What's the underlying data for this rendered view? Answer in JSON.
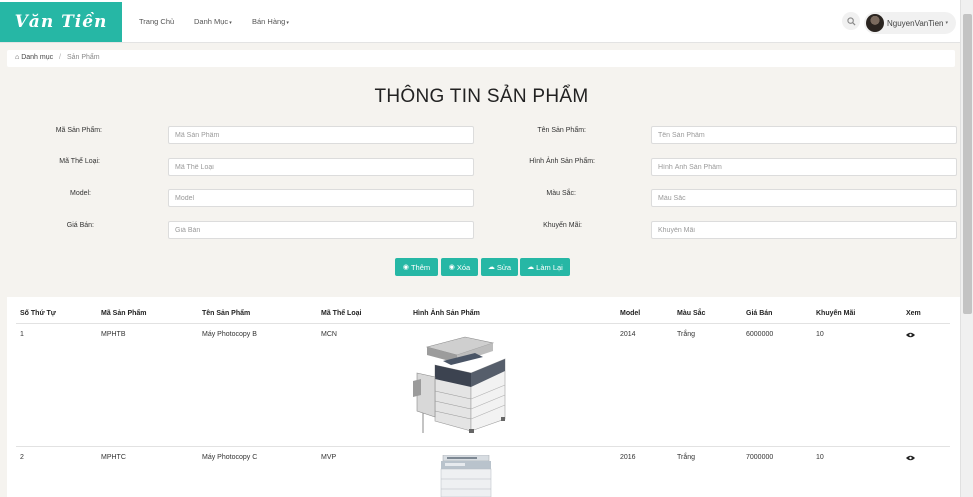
{
  "brand": {
    "logo_text": "Văn Tiền"
  },
  "nav": {
    "items": [
      {
        "label": "Trang Chủ",
        "has_caret": false
      },
      {
        "label": "Danh Mục",
        "has_caret": true
      },
      {
        "label": "Bán Hàng",
        "has_caret": true
      }
    ],
    "search_icon": "search-icon",
    "user": {
      "name": "NguyenVanTien",
      "caret": "▾"
    }
  },
  "breadcrumb": {
    "home_icon": "home-icon",
    "home_label": "Danh mục",
    "separator": "/",
    "current": "Sản Phẩm"
  },
  "page": {
    "title": "THÔNG TIN SẢN PHẨM"
  },
  "form": {
    "ma_san_pham": {
      "label": "Mã Sản Phẩm:",
      "placeholder": "Mã Sản Phẩm",
      "value": ""
    },
    "ten_san_pham": {
      "label": "Tên Sản Phẩm:",
      "placeholder": "Tên Sản Phẩm",
      "value": ""
    },
    "ma_the_loai": {
      "label": "Mã Thể Loại:",
      "placeholder": "Mã Thể Loại",
      "value": ""
    },
    "hinh_anh": {
      "label": "Hình Ảnh Sản Phẩm:",
      "placeholder": "Hình Ảnh Sản Phẩm",
      "value": ""
    },
    "model": {
      "label": "Model:",
      "placeholder": "Model",
      "value": ""
    },
    "mau_sac": {
      "label": "Màu Sắc:",
      "placeholder": "Màu Sắc",
      "value": ""
    },
    "gia_ban": {
      "label": "Giá Bán:",
      "placeholder": "Giá Bán",
      "value": ""
    },
    "khuyen_mai": {
      "label": "Khuyến Mãi:",
      "placeholder": "Khuyến Mãi",
      "value": ""
    }
  },
  "actions": {
    "add": {
      "label": "Thêm",
      "icon": "eye-icon"
    },
    "delete": {
      "label": "Xóa",
      "icon": "eye-icon"
    },
    "edit": {
      "label": "Sửa",
      "icon": "cloud-icon"
    },
    "reset": {
      "label": "Làm Lại",
      "icon": "cloud-icon"
    }
  },
  "table": {
    "headers": [
      "Số Thứ Tự",
      "Mã Sản Phẩm",
      "Tên Sản Phẩm",
      "Mã Thể Loại",
      "Hình Ảnh Sản Phẩm",
      "Model",
      "Màu Sắc",
      "Giá Bán",
      "Khuyến Mãi",
      "Xem"
    ],
    "rows": [
      {
        "stt": "1",
        "ma_sp": "MPHTB",
        "ten_sp": "Máy Photocopy B",
        "ma_tl": "MCN",
        "image": "photocopier-image",
        "model": "2014",
        "mau_sac": "Trắng",
        "gia_ban": "6000000",
        "khuyen_mai": "10",
        "view_icon": "eye-icon"
      },
      {
        "stt": "2",
        "ma_sp": "MPHTC",
        "ten_sp": "Máy Photocopy C",
        "ma_tl": "MVP",
        "image": "photocopier-image",
        "model": "2016",
        "mau_sac": "Trắng",
        "gia_ban": "7000000",
        "khuyen_mai": "10",
        "view_icon": "eye-icon"
      }
    ]
  },
  "colors": {
    "accent": "#26b7a5",
    "background": "#f5f3ef",
    "panel": "#ffffff"
  }
}
